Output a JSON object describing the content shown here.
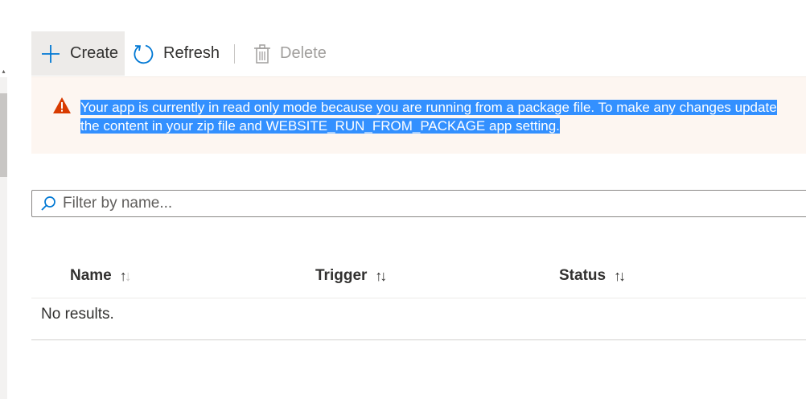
{
  "toolbar": {
    "create_label": "Create",
    "refresh_label": "Refresh",
    "delete_label": "Delete"
  },
  "banner": {
    "message": "Your app is currently in read only mode because you are running from a package file. To make any changes update the content in your zip file and WEBSITE_RUN_FROM_PACKAGE app setting.",
    "severity": "warning",
    "icon_color": "#d83b01"
  },
  "filter": {
    "placeholder": "Filter by name..."
  },
  "table": {
    "columns": [
      {
        "label": "Name"
      },
      {
        "label": "Trigger"
      },
      {
        "label": "Status"
      }
    ],
    "empty_text": "No results."
  },
  "colors": {
    "accent": "#0078d4",
    "selection": "#3390ff",
    "banner_bg": "#fdf6f1"
  }
}
